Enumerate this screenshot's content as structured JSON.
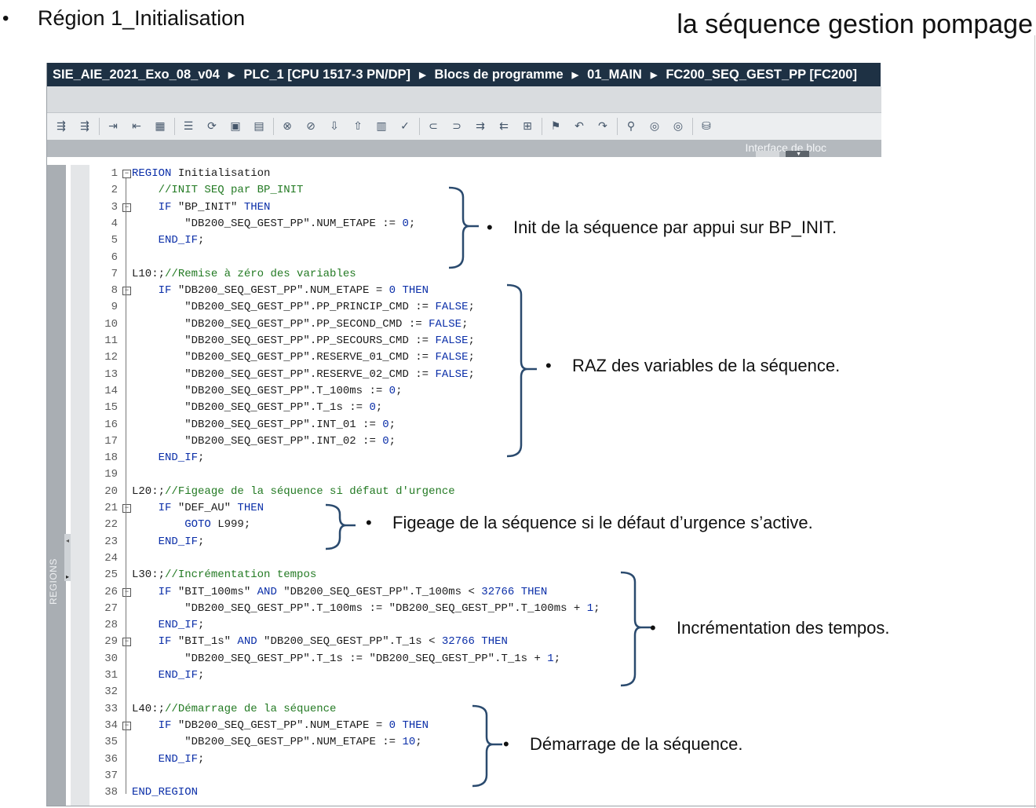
{
  "slide": {
    "bullet": "•",
    "title": "Région 1_Initialisation",
    "subtitle": "la séquence gestion pompage"
  },
  "editor": {
    "breadcrumb": [
      "SIE_AIE_2021_Exo_08_v04",
      "PLC_1 [CPU 1517-3 PN/DP]",
      "Blocs de programme",
      "01_MAIN",
      "FC200_SEQ_GEST_PP [FC200]"
    ],
    "breadcrumb_separator": "▶",
    "interface_label": "Interface de bloc",
    "regions_label": "REGIONS",
    "toolbar_icons": [
      "insert-network-icon",
      "insert-network-2-icon",
      "separator",
      "indent-icon",
      "outdent-icon",
      "monitor-icon",
      "separator",
      "list-icon",
      "sync-icon",
      "save-icon",
      "open-file-icon",
      "separator",
      "toggle-breakpoint-icon",
      "delete-breakpoint-icon",
      "download-icon",
      "upload-icon",
      "grid-icon",
      "check-icon",
      "separator",
      "comment-icon",
      "uncomment-icon",
      "indent-lines-icon",
      "outdent-lines-icon",
      "wrap-icon",
      "separator",
      "bookmark-icon",
      "bookmark-prev-icon",
      "bookmark-next-icon",
      "separator",
      "search-icon",
      "tag-icon",
      "tag-2-icon",
      "separator",
      "database-icon"
    ]
  },
  "code_lines": [
    {
      "n": "1",
      "fold": true,
      "parts": [
        {
          "t": "REGION",
          "c": "kw"
        },
        {
          "t": " Initialisation",
          "c": "plain"
        }
      ]
    },
    {
      "n": "2",
      "parts": [
        {
          "t": "    //INIT SEQ par BP_INIT",
          "c": "cmt"
        }
      ]
    },
    {
      "n": "3",
      "fold": true,
      "parts": [
        {
          "t": "    IF ",
          "c": "kw"
        },
        {
          "t": "\"BP_INIT\"",
          "c": "str"
        },
        {
          "t": " THEN",
          "c": "kw"
        }
      ]
    },
    {
      "n": "4",
      "parts": [
        {
          "t": "        \"DB200_SEQ_GEST_PP\".NUM_ETAPE := ",
          "c": "str"
        },
        {
          "t": "0",
          "c": "num"
        },
        {
          "t": ";",
          "c": "plain"
        }
      ]
    },
    {
      "n": "5",
      "parts": [
        {
          "t": "    END_IF",
          "c": "kw"
        },
        {
          "t": ";",
          "c": "plain"
        }
      ]
    },
    {
      "n": "6",
      "parts": []
    },
    {
      "n": "7",
      "parts": [
        {
          "t": "L10:;",
          "c": "plain"
        },
        {
          "t": "//Remise à zéro des variables",
          "c": "cmt"
        }
      ]
    },
    {
      "n": "8",
      "fold": true,
      "parts": [
        {
          "t": "    IF ",
          "c": "kw"
        },
        {
          "t": "\"DB200_SEQ_GEST_PP\".NUM_ETAPE = ",
          "c": "str"
        },
        {
          "t": "0",
          "c": "num"
        },
        {
          "t": " THEN",
          "c": "kw"
        }
      ]
    },
    {
      "n": "9",
      "parts": [
        {
          "t": "        \"DB200_SEQ_GEST_PP\".PP_PRINCIP_CMD := ",
          "c": "str"
        },
        {
          "t": "FALSE",
          "c": "kw"
        },
        {
          "t": ";",
          "c": "plain"
        }
      ]
    },
    {
      "n": "10",
      "parts": [
        {
          "t": "        \"DB200_SEQ_GEST_PP\".PP_SECOND_CMD := ",
          "c": "str"
        },
        {
          "t": "FALSE",
          "c": "kw"
        },
        {
          "t": ";",
          "c": "plain"
        }
      ]
    },
    {
      "n": "11",
      "parts": [
        {
          "t": "        \"DB200_SEQ_GEST_PP\".PP_SECOURS_CMD := ",
          "c": "str"
        },
        {
          "t": "FALSE",
          "c": "kw"
        },
        {
          "t": ";",
          "c": "plain"
        }
      ]
    },
    {
      "n": "12",
      "parts": [
        {
          "t": "        \"DB200_SEQ_GEST_PP\".RESERVE_01_CMD := ",
          "c": "str"
        },
        {
          "t": "FALSE",
          "c": "kw"
        },
        {
          "t": ";",
          "c": "plain"
        }
      ]
    },
    {
      "n": "13",
      "parts": [
        {
          "t": "        \"DB200_SEQ_GEST_PP\".RESERVE_02_CMD := ",
          "c": "str"
        },
        {
          "t": "FALSE",
          "c": "kw"
        },
        {
          "t": ";",
          "c": "plain"
        }
      ]
    },
    {
      "n": "14",
      "parts": [
        {
          "t": "        \"DB200_SEQ_GEST_PP\".T_100ms := ",
          "c": "str"
        },
        {
          "t": "0",
          "c": "num"
        },
        {
          "t": ";",
          "c": "plain"
        }
      ]
    },
    {
      "n": "15",
      "parts": [
        {
          "t": "        \"DB200_SEQ_GEST_PP\".T_1s := ",
          "c": "str"
        },
        {
          "t": "0",
          "c": "num"
        },
        {
          "t": ";",
          "c": "plain"
        }
      ]
    },
    {
      "n": "16",
      "parts": [
        {
          "t": "        \"DB200_SEQ_GEST_PP\".INT_01 := ",
          "c": "str"
        },
        {
          "t": "0",
          "c": "num"
        },
        {
          "t": ";",
          "c": "plain"
        }
      ]
    },
    {
      "n": "17",
      "parts": [
        {
          "t": "        \"DB200_SEQ_GEST_PP\".INT_02 := ",
          "c": "str"
        },
        {
          "t": "0",
          "c": "num"
        },
        {
          "t": ";",
          "c": "plain"
        }
      ]
    },
    {
      "n": "18",
      "parts": [
        {
          "t": "    END_IF",
          "c": "kw"
        },
        {
          "t": ";",
          "c": "plain"
        }
      ]
    },
    {
      "n": "19",
      "parts": []
    },
    {
      "n": "20",
      "parts": [
        {
          "t": "L20:;",
          "c": "plain"
        },
        {
          "t": "//Figeage de la séquence si défaut d'urgence",
          "c": "cmt"
        }
      ]
    },
    {
      "n": "21",
      "fold": true,
      "parts": [
        {
          "t": "    IF ",
          "c": "kw"
        },
        {
          "t": "\"DEF_AU\"",
          "c": "str"
        },
        {
          "t": " THEN",
          "c": "kw"
        }
      ]
    },
    {
      "n": "22",
      "parts": [
        {
          "t": "        GOTO",
          "c": "kw"
        },
        {
          "t": " L999;",
          "c": "plain"
        }
      ]
    },
    {
      "n": "23",
      "parts": [
        {
          "t": "    END_IF",
          "c": "kw"
        },
        {
          "t": ";",
          "c": "plain"
        }
      ]
    },
    {
      "n": "24",
      "parts": []
    },
    {
      "n": "25",
      "parts": [
        {
          "t": "L30:;",
          "c": "plain"
        },
        {
          "t": "//Incrémentation tempos",
          "c": "cmt"
        }
      ]
    },
    {
      "n": "26",
      "fold": true,
      "parts": [
        {
          "t": "    IF ",
          "c": "kw"
        },
        {
          "t": "\"BIT_100ms\"",
          "c": "str"
        },
        {
          "t": " AND ",
          "c": "kw"
        },
        {
          "t": "\"DB200_SEQ_GEST_PP\".T_100ms < ",
          "c": "str"
        },
        {
          "t": "32766",
          "c": "num"
        },
        {
          "t": " THEN",
          "c": "kw"
        }
      ]
    },
    {
      "n": "27",
      "parts": [
        {
          "t": "        \"DB200_SEQ_GEST_PP\".T_100ms := \"DB200_SEQ_GEST_PP\".T_100ms + ",
          "c": "str"
        },
        {
          "t": "1",
          "c": "num"
        },
        {
          "t": ";",
          "c": "plain"
        }
      ]
    },
    {
      "n": "28",
      "parts": [
        {
          "t": "    END_IF",
          "c": "kw"
        },
        {
          "t": ";",
          "c": "plain"
        }
      ]
    },
    {
      "n": "29",
      "fold": true,
      "parts": [
        {
          "t": "    IF ",
          "c": "kw"
        },
        {
          "t": "\"BIT_1s\"",
          "c": "str"
        },
        {
          "t": " AND ",
          "c": "kw"
        },
        {
          "t": "\"DB200_SEQ_GEST_PP\".T_1s < ",
          "c": "str"
        },
        {
          "t": "32766",
          "c": "num"
        },
        {
          "t": " THEN",
          "c": "kw"
        }
      ]
    },
    {
      "n": "30",
      "parts": [
        {
          "t": "        \"DB200_SEQ_GEST_PP\".T_1s := \"DB200_SEQ_GEST_PP\".T_1s + ",
          "c": "str"
        },
        {
          "t": "1",
          "c": "num"
        },
        {
          "t": ";",
          "c": "plain"
        }
      ]
    },
    {
      "n": "31",
      "parts": [
        {
          "t": "    END_IF",
          "c": "kw"
        },
        {
          "t": ";",
          "c": "plain"
        }
      ]
    },
    {
      "n": "32",
      "parts": []
    },
    {
      "n": "33",
      "parts": [
        {
          "t": "L40:;",
          "c": "plain"
        },
        {
          "t": "//Démarrage de la séquence",
          "c": "cmt"
        }
      ]
    },
    {
      "n": "34",
      "fold": true,
      "parts": [
        {
          "t": "    IF ",
          "c": "kw"
        },
        {
          "t": "\"DB200_SEQ_GEST_PP\".NUM_ETAPE = ",
          "c": "str"
        },
        {
          "t": "0",
          "c": "num"
        },
        {
          "t": " THEN",
          "c": "kw"
        }
      ]
    },
    {
      "n": "35",
      "parts": [
        {
          "t": "        \"DB200_SEQ_GEST_PP\".NUM_ETAPE := ",
          "c": "str"
        },
        {
          "t": "10",
          "c": "num"
        },
        {
          "t": ";",
          "c": "plain"
        }
      ]
    },
    {
      "n": "36",
      "parts": [
        {
          "t": "    END_IF",
          "c": "kw"
        },
        {
          "t": ";",
          "c": "plain"
        }
      ]
    },
    {
      "n": "37",
      "parts": []
    },
    {
      "n": "38",
      "parts": [
        {
          "t": "END_REGION",
          "c": "kw"
        }
      ]
    }
  ],
  "annotations": [
    {
      "bullet": "•",
      "text": "Init de la séquence par appui sur BP_INIT."
    },
    {
      "bullet": "•",
      "text": "RAZ des variables de la séquence."
    },
    {
      "bullet": "•",
      "text": "Figeage de la séquence si le défaut d’urgence s’active."
    },
    {
      "bullet": "•",
      "text": "Incrémentation des tempos."
    },
    {
      "bullet": "•",
      "text": "Démarrage de la séquence."
    }
  ],
  "colors": {
    "breadcrumb_bg": "#1e3144",
    "keyword": "#0a2ea8",
    "comment": "#237a23",
    "brace": "#2a4a6e"
  }
}
